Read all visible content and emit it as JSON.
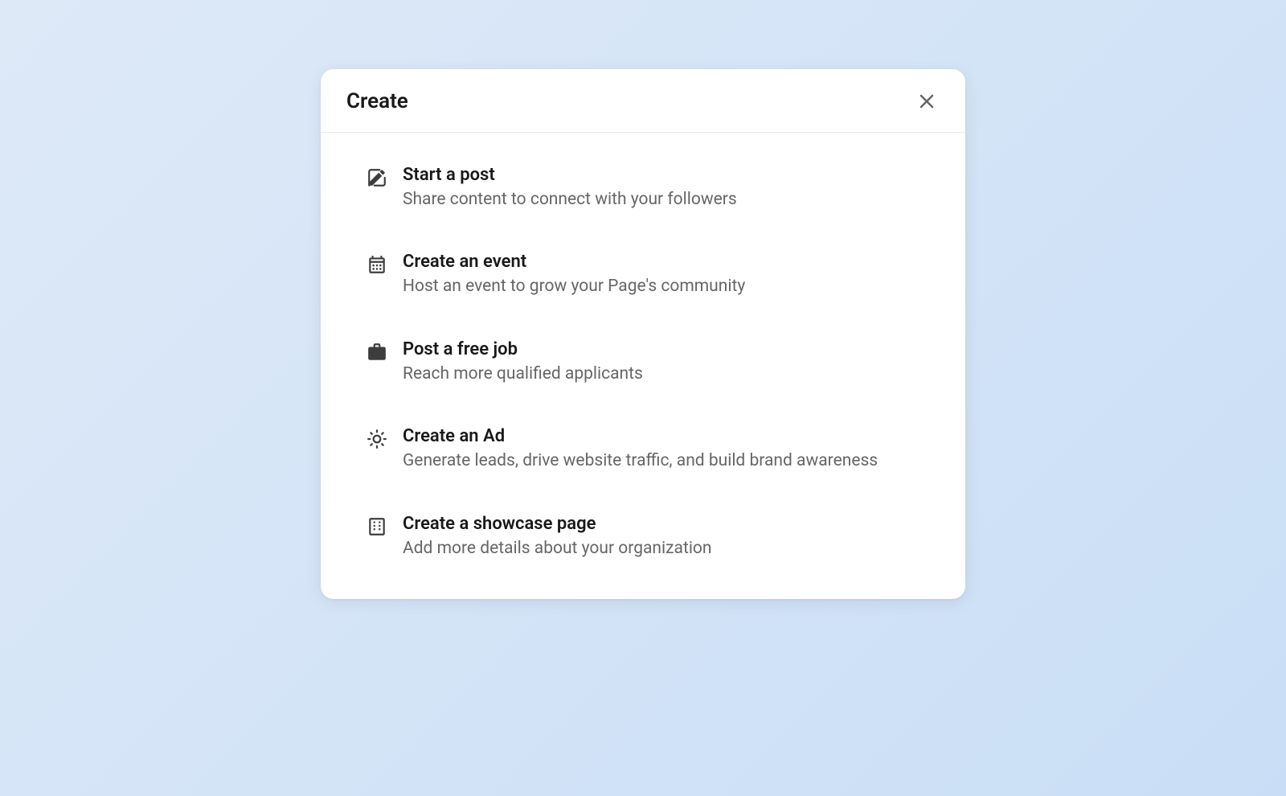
{
  "modal": {
    "title": "Create",
    "options": [
      {
        "title": "Start a post",
        "description": "Share content to connect with your followers"
      },
      {
        "title": "Create an event",
        "description": "Host an event to grow your Page's community"
      },
      {
        "title": "Post a free job",
        "description": "Reach more qualified applicants"
      },
      {
        "title": "Create an Ad",
        "description": "Generate leads, drive website traffic, and build brand awareness"
      },
      {
        "title": "Create a showcase page",
        "description": "Add more details about your organization"
      }
    ]
  }
}
